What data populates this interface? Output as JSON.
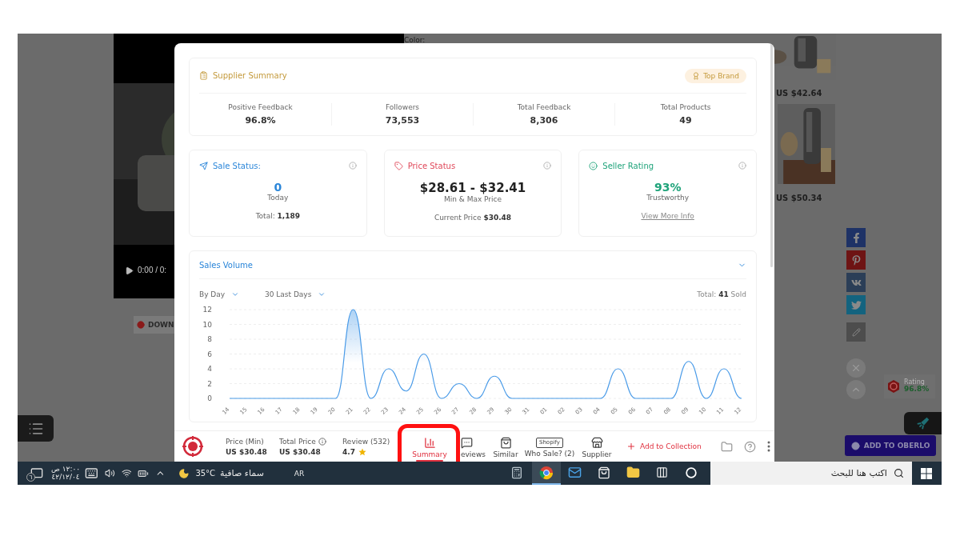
{
  "background_page": {
    "color_label": "Color:",
    "video": {
      "kind": "picture",
      "time": "0:00 / 0:"
    },
    "download_button": "DOWN",
    "products": [
      {
        "kind": "picture",
        "price": "US $42.64"
      },
      {
        "kind": "picture",
        "price": "US $50.34"
      }
    ],
    "rating_badge": {
      "label": "Rating",
      "value": "96.8%"
    },
    "oberlo_button": "ADD TO OBERLO"
  },
  "supplier_summary": {
    "title": "Supplier Summary",
    "badge": "Top Brand",
    "stats": [
      {
        "label": "Positive Feedback",
        "value": "96.8%"
      },
      {
        "label": "Followers",
        "value": "73,553"
      },
      {
        "label": "Total Feedback",
        "value": "8,306"
      },
      {
        "label": "Total Products",
        "value": "49"
      }
    ]
  },
  "status_cards": [
    {
      "kind": "sale",
      "title": "Sale Status:",
      "color": "#2b86d9",
      "value": "0",
      "caption": "Today",
      "footer_label": "Total:",
      "footer_value": "1,189"
    },
    {
      "kind": "price",
      "title": "Price Status",
      "color": "#e0485a",
      "value": "$28.61 - $32.41",
      "caption": "Min & Max Price",
      "footer_label": "Current Price",
      "footer_value": "$30.48"
    },
    {
      "kind": "rating",
      "title": "Seller Rating",
      "color": "#1fa37a",
      "value": "93%",
      "caption": "Trustworthy",
      "link": "View More Info"
    }
  ],
  "sales_volume": {
    "title": "Sales Volume",
    "expanded": true,
    "period_filter": "By Day",
    "range_filter": "30 Last Days",
    "total": "Total: **41** Sold",
    "chart_data": {
      "type": "area",
      "grid": true,
      "categories": [
        "14",
        "15",
        "16",
        "17",
        "18",
        "19",
        "20",
        "21",
        "22",
        "23",
        "24",
        "25",
        "26",
        "27",
        "28",
        "29",
        "30",
        "31",
        "01",
        "02",
        "03",
        "04",
        "05",
        "06",
        "07",
        "08",
        "09",
        "10",
        "11",
        "12"
      ],
      "series": [
        {
          "color": "#4a9be8",
          "values": [
            0,
            0,
            0,
            0,
            0,
            0,
            0,
            12,
            0,
            4,
            1,
            6,
            0,
            2,
            0,
            3,
            0,
            0,
            0,
            0,
            0,
            0,
            4,
            0,
            0,
            0,
            5,
            0,
            4,
            0
          ]
        }
      ],
      "ylim": [
        0,
        12
      ],
      "yticks": [
        0,
        2,
        4,
        6,
        8,
        10,
        12
      ]
    }
  },
  "bottom_bar": {
    "prices": [
      {
        "label": "Price (Min)",
        "value": "US $30.48",
        "info": false
      },
      {
        "label": "Total Price",
        "value": "US $30.48",
        "info": true
      }
    ],
    "review": {
      "label": "Review (532)",
      "value": "4.7"
    },
    "tabs": [
      {
        "kind": "summary",
        "label": "Summary",
        "selected": true
      },
      {
        "kind": "reviews",
        "label": "eviews",
        "selected": false
      },
      {
        "kind": "similar",
        "label": "Similar",
        "selected": false
      },
      {
        "kind": "shopify",
        "label": "Who Sale? (2)",
        "selected": false,
        "icon_text": "Shopify"
      },
      {
        "kind": "supplier",
        "label": "Supplier",
        "selected": false
      }
    ],
    "add_button": "Add to Collection"
  },
  "taskbar": {
    "notification_count": "٦",
    "time": "١٢:٠٠ ص",
    "date": "٤٢/١٢/٠٤",
    "temperature": "35°C",
    "weather": "سماء صافية",
    "language": "AR",
    "apps": [
      {
        "kind": "calculator",
        "selected": false
      },
      {
        "kind": "chrome",
        "selected": true
      },
      {
        "kind": "mail",
        "selected": false
      },
      {
        "kind": "store",
        "selected": false
      },
      {
        "kind": "explorer",
        "selected": false
      },
      {
        "kind": "taskview",
        "selected": false
      },
      {
        "kind": "cortana",
        "selected": false
      }
    ],
    "search_placeholder": "اكتب هنا للبحث"
  }
}
